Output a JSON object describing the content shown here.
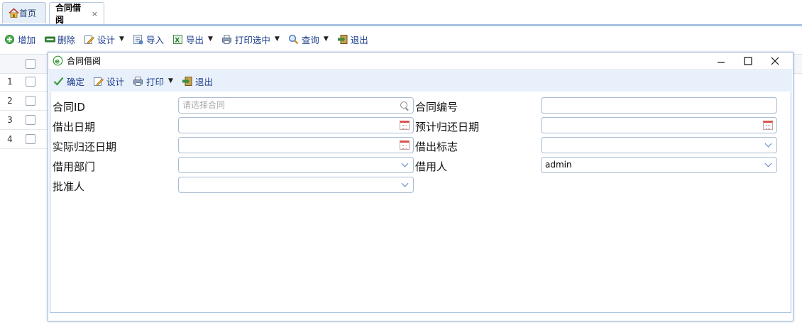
{
  "tabs": [
    {
      "label": "首页",
      "icon": "home-icon"
    },
    {
      "label": "合同借阅",
      "close": "×"
    }
  ],
  "toolbar": {
    "add": "增加",
    "delete": "删除",
    "design": "设计",
    "import": "导入",
    "export": "导出",
    "print_selected": "打印选中",
    "query": "查询",
    "exit": "退出"
  },
  "grid": {
    "rows": [
      "1",
      "2",
      "3",
      "4"
    ]
  },
  "dialog": {
    "title": "合同借阅",
    "toolbar": {
      "confirm": "确定",
      "design": "设计",
      "print": "打印",
      "exit": "退出"
    },
    "fields": {
      "contract_id": {
        "label": "合同ID",
        "placeholder": "请选择合同"
      },
      "contract_no": {
        "label": "合同编号",
        "value": ""
      },
      "borrow_date": {
        "label": "借出日期",
        "value": ""
      },
      "expected_return_date": {
        "label": "预计归还日期",
        "value": ""
      },
      "actual_return_date": {
        "label": "实际归还日期",
        "value": ""
      },
      "borrow_flag": {
        "label": "借出标志",
        "value": ""
      },
      "borrow_dept": {
        "label": "借用部门",
        "value": ""
      },
      "borrower": {
        "label": "借用人",
        "value": "admin"
      },
      "approver": {
        "label": "批准人",
        "value": ""
      }
    }
  },
  "colors": {
    "accent": "#a9c1e1",
    "link": "#1f3f8f",
    "dialog_toolbar_bg": "#e8f0fb"
  }
}
